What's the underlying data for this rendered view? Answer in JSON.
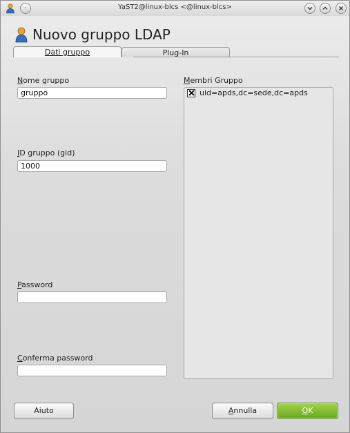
{
  "window": {
    "title": "YaST2@linux-blcs <@linux-blcs>"
  },
  "dialog": {
    "heading": "Nuovo gruppo LDAP",
    "heading_icon": "user-group-icon"
  },
  "tabs": [
    {
      "label": "Dati gruppo",
      "active": true
    },
    {
      "label": "Plug-In",
      "active": false
    }
  ],
  "form": {
    "group_name": {
      "label_mnemonic": "N",
      "label_rest": "ome gruppo",
      "value": "gruppo"
    },
    "gid": {
      "label_mnemonic": "I",
      "label_rest": "D gruppo (gid)",
      "value": "1000"
    },
    "password": {
      "label_mnemonic": "P",
      "label_rest": "assword",
      "value": ""
    },
    "confirm_password": {
      "label_mnemonic": "C",
      "label_rest": "onferma password",
      "value": ""
    }
  },
  "members": {
    "label_mnemonic": "M",
    "label_rest": "embri Gruppo",
    "items": [
      {
        "label": "uid=apds,dc=sede,dc=apds",
        "checked": true
      }
    ]
  },
  "buttons": {
    "help": "Aiuto",
    "cancel_mnemonic": "A",
    "cancel_rest": "nnulla",
    "ok_mnemonic": "O",
    "ok_rest": "K"
  },
  "colors": {
    "ok_button": "#7ab82e",
    "window_bg": "#d6d6d6"
  }
}
